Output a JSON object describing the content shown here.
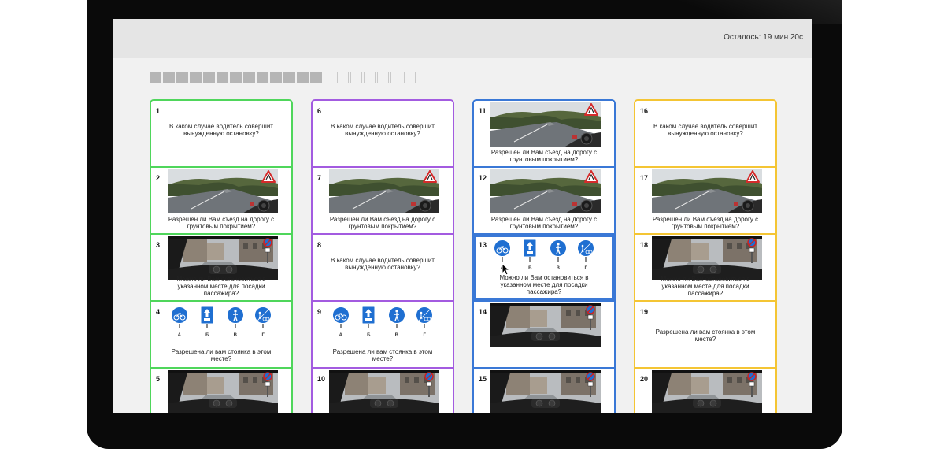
{
  "timer": {
    "text": "Осталось: 19 мин 20с"
  },
  "progress": {
    "total": 20,
    "answered": 13
  },
  "columns": [
    {
      "color": "#4fd65b",
      "cards": [
        {
          "num": "1",
          "type": "text",
          "text": "В каком случае водитель совершит вынужденную остановку?"
        },
        {
          "num": "2",
          "type": "road",
          "text": "Разрешён ли Вам съезд на дорогу с грунтовым покрытием?"
        },
        {
          "num": "3",
          "type": "street",
          "text": "Можно ли Вам остановиться в указанном месте для посадки пассажира?"
        },
        {
          "num": "4",
          "type": "signs",
          "text": "Разрешена ли вам стоянка в этом месте?"
        },
        {
          "num": "5",
          "type": "street",
          "text": ""
        }
      ]
    },
    {
      "color": "#a35be0",
      "cards": [
        {
          "num": "6",
          "type": "text",
          "text": "В каком случае водитель совершит вынужденную остановку?"
        },
        {
          "num": "7",
          "type": "road",
          "text": "Разрешён ли Вам съезд на дорогу с грунтовым покрытием?"
        },
        {
          "num": "8",
          "type": "text",
          "text": "В каком случае водитель совершит вынужденную остановку?"
        },
        {
          "num": "9",
          "type": "signs",
          "text": "Разрешена ли вам стоянка в этом месте?"
        },
        {
          "num": "10",
          "type": "street",
          "text": ""
        }
      ]
    },
    {
      "color": "#3a78d6",
      "cards": [
        {
          "num": "11",
          "type": "road",
          "text": "Разрешён ли Вам съезд на дорогу с грунтовым покрытием?"
        },
        {
          "num": "12",
          "type": "road",
          "text": "Разрешён ли Вам съезд на дорогу с грунтовым покрытием?"
        },
        {
          "num": "13",
          "type": "signs",
          "text": "Можно ли Вам остановиться в указанном месте для посадки пассажира?",
          "selected": true
        },
        {
          "num": "14",
          "type": "street",
          "text": ""
        },
        {
          "num": "15",
          "type": "street",
          "text": ""
        }
      ]
    },
    {
      "color": "#f4c534",
      "cards": [
        {
          "num": "16",
          "type": "text",
          "text": "В каком случае водитель совершит вынужденную остановку?"
        },
        {
          "num": "17",
          "type": "road",
          "text": "Разрешён ли Вам съезд на дорогу с грунтовым покрытием?"
        },
        {
          "num": "18",
          "type": "street",
          "text": "Можно ли Вам остановиться в указанном месте для посадки пассажира?"
        },
        {
          "num": "19",
          "type": "text",
          "text": "Разрешена ли вам стоянка в этом месте?"
        },
        {
          "num": "20",
          "type": "street",
          "text": ""
        }
      ]
    }
  ],
  "sign_letters": [
    "А",
    "Б",
    "В",
    "Г"
  ],
  "colors": {
    "sign_blue": "#1f6fd1",
    "selected": "#3a78d6"
  }
}
